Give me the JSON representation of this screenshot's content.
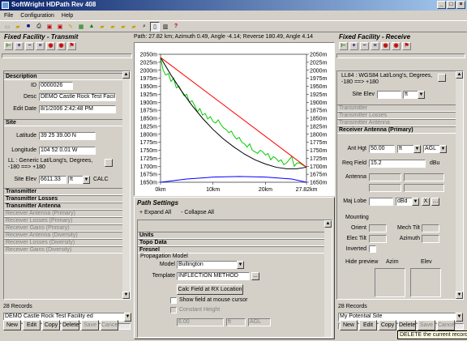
{
  "app": {
    "title": "SoftWright HDPath Rev 408"
  },
  "menu": [
    "File",
    "Configuration",
    "Help"
  ],
  "path_info": "Path: 27.82 km; Azimuth 0.49, Angle -4.14; Reverse 180.49, Angle 4.14",
  "left": {
    "header": "Fixed Facility - Transmit",
    "description": {
      "title": "Description",
      "id_label": "ID",
      "id_value": "0000026",
      "desc_label": "Desc",
      "desc_value": "DEMO Castle Rock Test Facili",
      "edit_label": "Edit Date",
      "edit_value": "8/1/2006 2:42:48 PM"
    },
    "site": {
      "title": "Site",
      "lat_label": "Latitude",
      "lat_value": "39 25 39.00 N",
      "lon_label": "Longitude",
      "lon_value": "104 52 0.01 W",
      "ll_text": "LL : Generic Lat/Long's, Degrees, -180 ==> +180",
      "elev_label": "Site Elev",
      "elev_value": "6611.33",
      "elev_unit": "ft",
      "calc": "CALC"
    },
    "sections": [
      "Transmitter",
      "Transmitter Losses",
      "Transmitter Antenna",
      "Receiver Antenna (Primary)",
      "Receiver Losses (Primary)",
      "Receiver Gains (Primary)",
      "Receiver Antenna (Diversity)",
      "Receiver Losses (Diversity)",
      "Receiver Gains (Diversity)"
    ],
    "records": "28 Records",
    "record_value": "DEMO Castle Rock Test Facility ed",
    "buttons": [
      "New",
      "Edit",
      "Copy",
      "Delete",
      "Save",
      "Cancel"
    ]
  },
  "right": {
    "header": "Fixed Facility - Receive",
    "ll_text": "LL84 : WGS84 Lat/Long's, Degrees, -180 ==> +180",
    "elev_label": "Site Elev",
    "elev_unit": "ft",
    "sections_dim": [
      "Transmitter",
      "Transmitter Losses",
      "Transmitter Antenna"
    ],
    "rx_title": "Receiver Antenna (Primary)",
    "ant_hgt_label": "Ant Hgt",
    "ant_hgt_value": "50.00",
    "ant_hgt_unit": "ft",
    "ant_hgt_ref": "AGL",
    "req_field_label": "Req Field",
    "req_field_value": "15.2",
    "req_field_unit": "dBu",
    "antenna_label": "Antenna",
    "maj_lobe_label": "Maj Lobe",
    "maj_lobe_unit": "dBd",
    "x_label": "X",
    "mounting_label": "Mounting",
    "orient_label": "Orient",
    "mech_tilt_label": "Mech Tilt",
    "elec_tilt_label": "Elec Tilt",
    "azimuth_label": "Azimuth",
    "inverted_label": "Inverted",
    "hide_preview_label": "Hide preview",
    "azim_label": "Azim",
    "elev_col_label": "Elev",
    "records": "28 Records",
    "record_value": "My Potential Site",
    "buttons": [
      "New",
      "Edit",
      "Copy",
      "Delete",
      "Save",
      "Cancel"
    ],
    "tooltip": "DELETE the current record"
  },
  "path_settings": {
    "title": "Path Settings",
    "expand": "+ Expand All",
    "collapse": "- Collapse All",
    "sections": [
      "Units",
      "Topo Data",
      "Fresnel"
    ],
    "prop_model_title": "Propagation Model",
    "model_label": "Model",
    "model_value": "Bullington",
    "template_label": "Template",
    "template_value": "INFLECTION METHOD",
    "browse": "...",
    "calc_button": "Calc Field at RX Location",
    "show_field": "Show field at mouse cursor",
    "constant_height": "Constant Height",
    "height_value": "6.00",
    "height_unit": "ft",
    "height_ref": "AGL"
  },
  "chart_data": {
    "type": "line",
    "y_ticks": [
      "2050m",
      "2025m",
      "2000m",
      "1975m",
      "1950m",
      "1925m",
      "1900m",
      "1875m",
      "1850m",
      "1825m",
      "1800m",
      "1775m",
      "1750m",
      "1725m",
      "1700m",
      "1675m",
      "1650m"
    ],
    "x_ticks": [
      "0km",
      "10km",
      "20km",
      "27.82km"
    ],
    "ylim": [
      1650,
      2050
    ],
    "xlim": [
      0,
      27.82
    ],
    "series": [
      {
        "color": "#00cc00",
        "x": [
          0,
          0.5,
          1,
          1.5,
          2,
          2.5,
          3,
          3.5,
          4,
          4.5,
          5,
          5.5,
          6,
          6.5,
          7,
          7.5,
          8,
          8.5,
          9,
          9.5,
          10,
          10.5,
          11,
          11.5,
          12,
          12.5,
          13,
          13.5,
          14,
          14.5,
          15,
          15.5,
          16,
          16.5,
          17,
          17.5,
          18,
          18.5,
          19,
          19.5,
          20,
          20.5,
          21,
          21.5,
          22,
          22.5,
          23,
          23.5,
          24,
          24.5,
          25,
          25.5,
          26,
          26.5,
          27,
          27.5,
          27.82
        ],
        "values": [
          2040,
          2000,
          1985,
          1990,
          1965,
          1975,
          1945,
          1950,
          1935,
          1920,
          1925,
          1900,
          1905,
          1890,
          1870,
          1880,
          1860,
          1865,
          1848,
          1855,
          1840,
          1835,
          1845,
          1830,
          1820,
          1815,
          1805,
          1810,
          1795,
          1785,
          1790,
          1775,
          1770,
          1760,
          1770,
          1750,
          1745,
          1740,
          1750,
          1745,
          1735,
          1740,
          1720,
          1730,
          1725,
          1715,
          1720,
          1705,
          1710,
          1720,
          1730,
          1700,
          1710,
          1710,
          1705,
          1700,
          1695
        ]
      },
      {
        "color": "#000000",
        "x": [
          0,
          2,
          4,
          6,
          8,
          10,
          12,
          14,
          16,
          18,
          20,
          22,
          24,
          26,
          27.82
        ],
        "values": [
          2040,
          1985,
          1935,
          1890,
          1850,
          1815,
          1785,
          1760,
          1738,
          1720,
          1707,
          1697,
          1692,
          1692,
          1697
        ]
      },
      {
        "color": "#ff0000",
        "x": [
          0,
          27.82
        ],
        "values": [
          2040,
          1697
        ]
      },
      {
        "color": "#0000ff",
        "x": [
          0,
          5,
          10,
          15,
          20,
          25,
          27.82
        ],
        "values": [
          1650,
          1660,
          1666,
          1668,
          1666,
          1660,
          1650
        ]
      }
    ]
  }
}
